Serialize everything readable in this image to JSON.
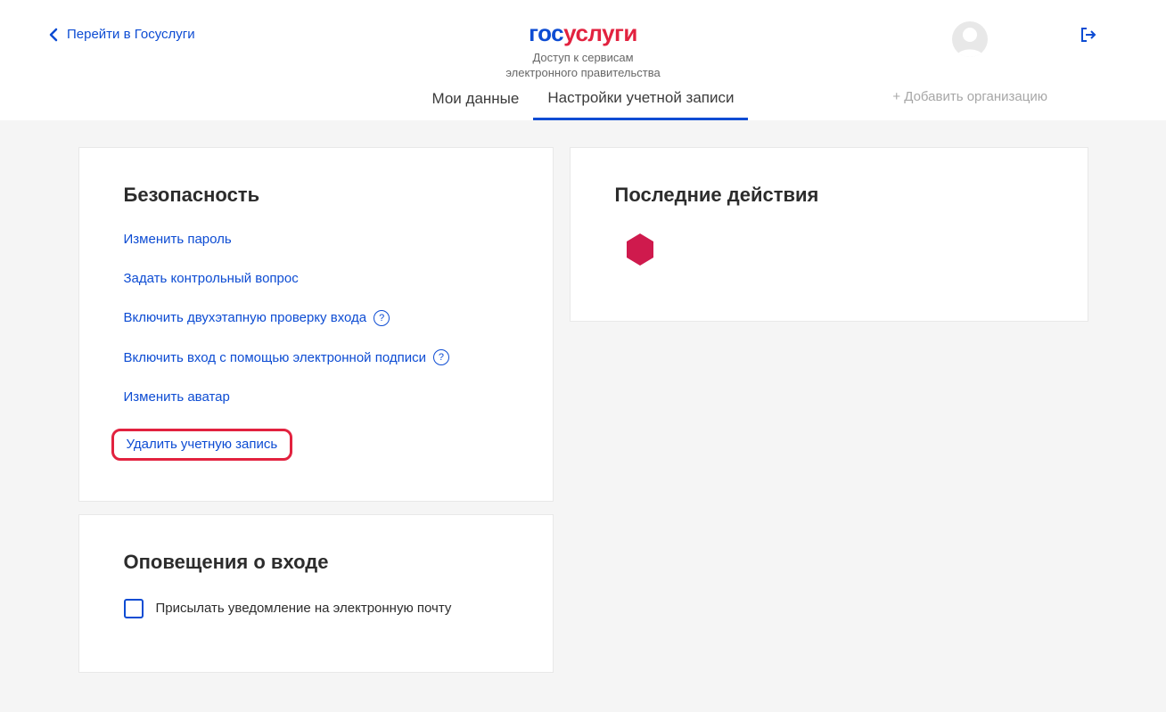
{
  "header": {
    "back_label": "Перейти в Госуслуги",
    "logo_gos": "гос",
    "logo_uslugi": "услуги",
    "slogan_line1": "Доступ к сервисам",
    "slogan_line2": "электронного правительства"
  },
  "tabs": {
    "my_data": "Мои данные",
    "account_settings": "Настройки учетной записи",
    "add_org": "+ Добавить организацию"
  },
  "security": {
    "title": "Безопасность",
    "change_password": "Изменить пароль",
    "set_question": "Задать контрольный вопрос",
    "two_factor": "Включить двухэтапную проверку входа",
    "electronic_signature": "Включить вход с помощью электронной подписи",
    "change_avatar": "Изменить аватар",
    "delete_account": "Удалить учетную запись",
    "help_symbol": "?"
  },
  "notifications": {
    "title": "Оповещения о входе",
    "email_checkbox": "Присылать уведомление на электронную почту"
  },
  "recent": {
    "title": "Последние действия"
  }
}
